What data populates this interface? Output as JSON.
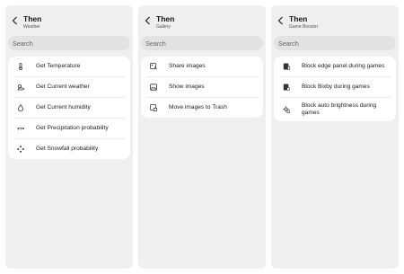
{
  "panels": [
    {
      "title": "Then",
      "subtitle": "Weather",
      "search_placeholder": "Search",
      "items": [
        {
          "label": "Get Temperature",
          "icon": "thermometer-icon"
        },
        {
          "label": "Get Current weather",
          "icon": "weather-icon"
        },
        {
          "label": "Get Current humidity",
          "icon": "humidity-icon"
        },
        {
          "label": "Get Precipitation probability",
          "icon": "precipitation-icon"
        },
        {
          "label": "Get Snowfall probability",
          "icon": "snowflake-icon"
        }
      ]
    },
    {
      "title": "Then",
      "subtitle": "Gallery",
      "search_placeholder": "Search",
      "items": [
        {
          "label": "Share images",
          "icon": "share-image-icon"
        },
        {
          "label": "Show images",
          "icon": "image-icon"
        },
        {
          "label": "Move images to Trash",
          "icon": "trash-image-icon"
        }
      ]
    },
    {
      "title": "Then",
      "subtitle": "Game Booster",
      "search_placeholder": "Search",
      "items": [
        {
          "label": "Block edge panel during games",
          "icon": "edge-panel-icon"
        },
        {
          "label": "Block Bixby during games",
          "icon": "bixby-block-icon"
        },
        {
          "label": "Block auto brightness during games",
          "icon": "brightness-icon"
        }
      ]
    }
  ]
}
